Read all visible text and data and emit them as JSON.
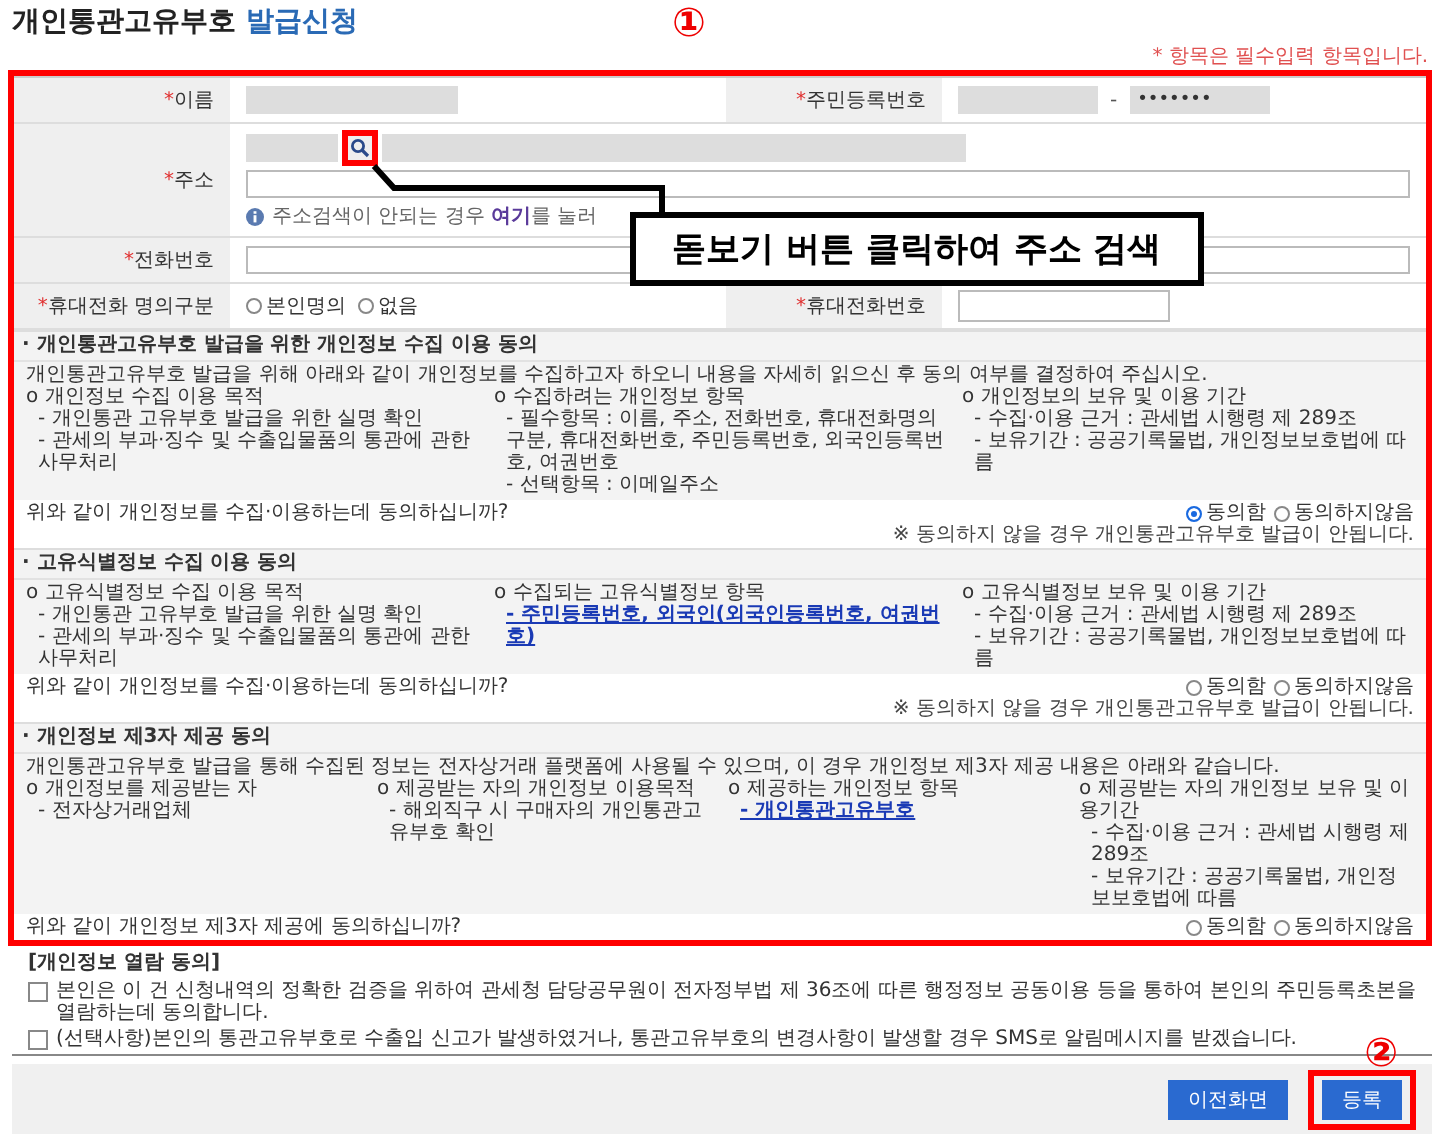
{
  "title": {
    "main": "개인통관고유부호",
    "sub": "발급신청"
  },
  "annotations": {
    "first": "①",
    "second": "②",
    "callout": "돋보기 버튼 클릭하여 주소 검색"
  },
  "notice": "* 항목은 필수입력 항목입니다.",
  "form": {
    "name": {
      "required_mark": "*",
      "label": "이름"
    },
    "resident_number": {
      "required_mark": "*",
      "label": "주민등록번호",
      "separator": "-",
      "masked": "•••••••"
    },
    "address": {
      "required_mark": "*",
      "label": "주소",
      "hint": "주소검색이 안되는 경우 **여기**를 눌러"
    },
    "phone": {
      "required_mark": "*",
      "label": "전화번호"
    },
    "mobile_owner": {
      "required_mark": "*",
      "label": "휴대전화 명의구분",
      "options": [
        {
          "label": "본인명의",
          "selected": false
        },
        {
          "label": "없음",
          "selected": false
        }
      ]
    },
    "mobile": {
      "required_mark": "*",
      "label": "휴대전화번호"
    }
  },
  "sections": [
    {
      "title": "· 개인통관고유부호 발급을 위한 개인정보 수집 이용 동의",
      "intro": "개인통관고유부호 발급을 위해 아래와 같이 개인정보를 수집하고자 하오니 내용을 자세히 읽으신 후 동의 여부를 결정하여 주십시오.",
      "groups": [
        {
          "heading": "o 개인정보 수집 이용 목적",
          "lines": [
            {
              "kind": "plain",
              "text": "- 개인통관 고유부호 발급을 위한 실명 확인"
            },
            {
              "kind": "plain",
              "text": "- 관세의 부과·징수 및 수출입물품의 통관에 관한 사무처리"
            }
          ]
        },
        {
          "heading": "o 수집하려는 개인정보 항목",
          "lines": [
            {
              "kind": "plain",
              "text": "- 필수항목 : 이름, 주소, 전화번호, 휴대전화명의구분, 휴대전화번호, 주민등록번호, 외국인등록번호, 여권번호"
            },
            {
              "kind": "plain",
              "text": "- 선택항목 : 이메일주소"
            }
          ]
        },
        {
          "heading": "o 개인정보의 보유 및 이용 기간",
          "lines": [
            {
              "kind": "plain",
              "text": "- 수집·이용 근거 : 관세법 시행령 제 289조"
            },
            {
              "kind": "plain",
              "text": "- 보유기간 : 공공기록물법, 개인정보보호법에 따름"
            }
          ]
        }
      ],
      "question": "위와 같이 개인정보를 수집·이용하는데 동의하십니까?",
      "options": [
        {
          "label": "동의함",
          "selected": true
        },
        {
          "label": "동의하지않음",
          "selected": false
        }
      ],
      "note": "※ 동의하지 않을 경우 개인통관고유부호 발급이 안됩니다."
    },
    {
      "title": "· 고유식별정보 수집 이용 동의",
      "groups": [
        {
          "heading": "o 고유식별정보 수집 이용 목적",
          "lines": [
            {
              "kind": "plain",
              "text": "- 개인통관 고유부호 발급을 위한 실명 확인"
            },
            {
              "kind": "plain",
              "text": "- 관세의 부과·징수 및 수출입물품의 통관에 관한 사무처리"
            }
          ]
        },
        {
          "heading": "o 수집되는 고유식별정보 항목",
          "lines": [
            {
              "kind": "link",
              "text": "- 주민등록번호, 외국인(외국인등록번호, 여권번호)"
            }
          ]
        },
        {
          "heading": "o 고유식별정보 보유 및 이용 기간",
          "lines": [
            {
              "kind": "plain",
              "text": "- 수집·이용 근거 : 관세법 시행령 제 289조"
            },
            {
              "kind": "plain",
              "text": "- 보유기간 : 공공기록물법, 개인정보보호법에 따름"
            }
          ]
        }
      ],
      "question": "위와 같이 개인정보를 수집·이용하는데 동의하십니까?",
      "options": [
        {
          "label": "동의함",
          "selected": false
        },
        {
          "label": "동의하지않음",
          "selected": false
        }
      ],
      "note": "※ 동의하지 않을 경우 개인통관고유부호 발급이 안됩니다."
    },
    {
      "title": "· 개인정보 제3자 제공 동의",
      "intro": "개인통관고유부호 발급을 통해 수집된 정보는 전자상거래 플랫폼에 사용될 수 있으며, 이 경우 개인정보 제3자 제공 내용은 아래와 같습니다.",
      "groups": [
        {
          "heading": "o 개인정보를 제공받는 자",
          "lines": [
            {
              "kind": "plain",
              "text": "- 전자상거래업체"
            }
          ]
        },
        {
          "heading": "o 제공받는 자의 개인정보 이용목적",
          "lines": [
            {
              "kind": "plain",
              "text": "- 해외직구 시 구매자의 개인통관고유부호 확인"
            }
          ]
        },
        {
          "heading": "o 제공하는 개인정보 항목",
          "lines": [
            {
              "kind": "link",
              "text": "- 개인통관고유부호"
            }
          ]
        },
        {
          "heading": "o 제공받는 자의 개인정보 보유 및 이용기간",
          "lines": [
            {
              "kind": "plain",
              "text": "- 수집·이용 근거 : 관세법 시행령 제289조"
            },
            {
              "kind": "plain",
              "text": "- 보유기간 : 공공기록물법, 개인정보보호법에 따름"
            }
          ]
        }
      ],
      "question": "위와 같이 개인정보 제3자 제공에 동의하십니까?",
      "options": [
        {
          "label": "동의함",
          "selected": false
        },
        {
          "label": "동의하지않음",
          "selected": false
        }
      ]
    }
  ],
  "view_consent": {
    "title": "[개인정보 열람 동의]",
    "items": [
      {
        "text": "본인은 이 건 신청내역의 정확한 검증을 위하여 관세청 담당공무원이 전자정부법 제 36조에 따른 행정정보 공동이용 등을 통하여 본인의 주민등록초본을 열람하는데 동의합니다.",
        "checked": false
      },
      {
        "text": "(선택사항)본인의 통관고유부호로 수출입 신고가 발생하였거나, 통관고유부호의 변경사항이 발생할 경우 SMS로 알림메시지를 받겠습니다.",
        "checked": false
      }
    ]
  },
  "buttons": {
    "back": "이전화면",
    "submit": "등록"
  }
}
